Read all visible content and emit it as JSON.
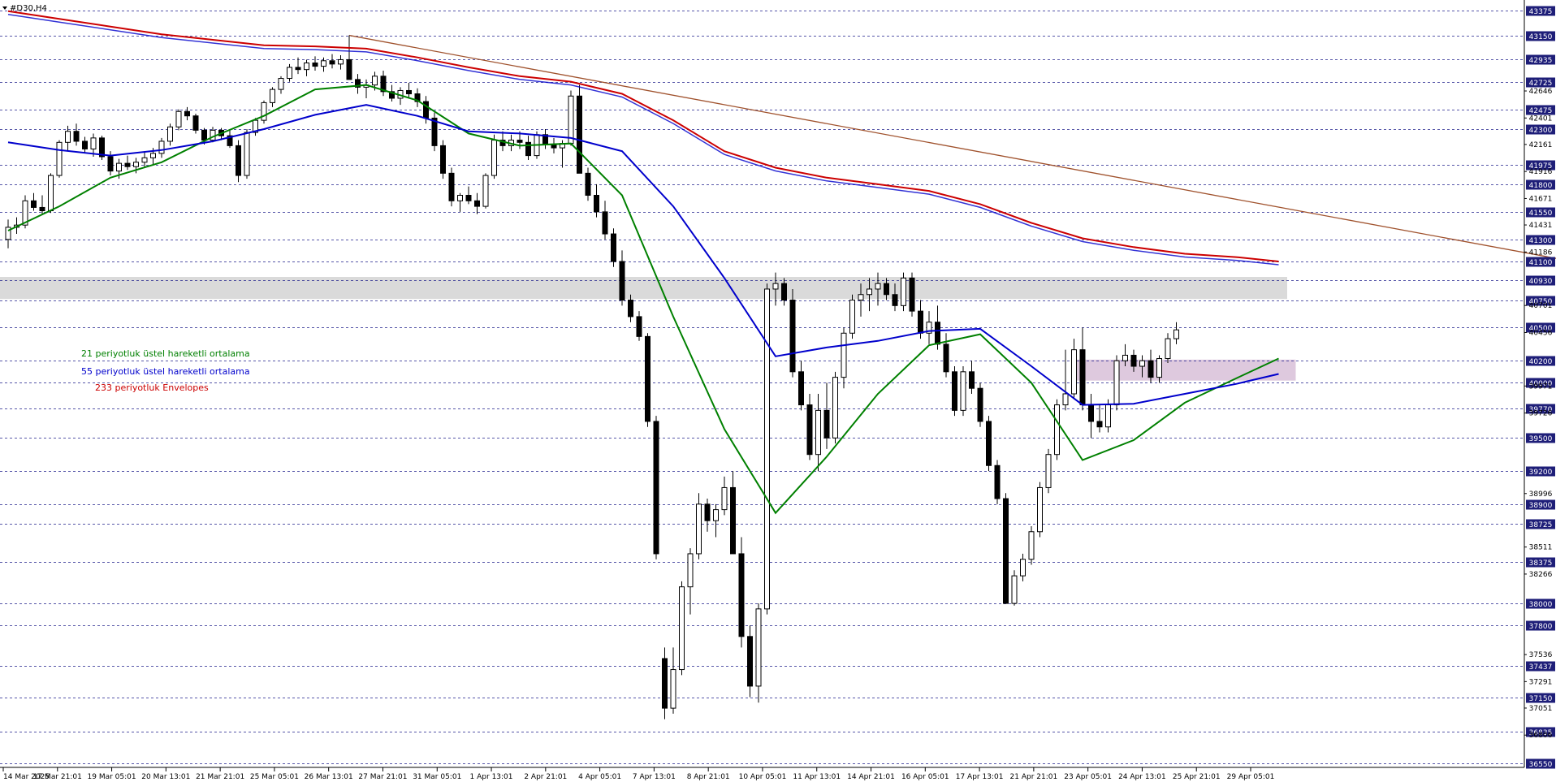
{
  "window": {
    "title": "#D30,H4"
  },
  "legend": [
    {
      "label": "21 periyotluk üstel hareketli ortalama",
      "color": "#008000"
    },
    {
      "label": "55 periyotluk üstel hareketli ortalama",
      "color": "#0000cc"
    },
    {
      "label": "233 periyotluk Envelopes",
      "color": "#cc0000"
    }
  ],
  "colors": {
    "background": "#ffffff",
    "grid": "#1e1e8c",
    "candle_body_up": "#ffffff",
    "candle_body_down": "#000000",
    "trendline": "#a0522d",
    "price_tag": "#1e1e78",
    "resistance_zone": "#d3d3d3",
    "support_zone": "#d8bfd8"
  },
  "chart_data": {
    "type": "candlestick",
    "symbol": "#D30",
    "timeframe": "H4",
    "ylim": [
      36550,
      43500
    ],
    "price_levels": [
      "43375",
      "43150",
      "42935",
      "42725",
      "42475",
      "42300",
      "41975",
      "41800",
      "41550",
      "41300",
      "41100",
      "40930",
      "40750",
      "40500",
      "40200",
      "40000",
      "39770",
      "39500",
      "39200",
      "38900",
      "38725",
      "38375",
      "38000",
      "37800",
      "37437",
      "37150",
      "36835",
      "36550"
    ],
    "minor_price_labels": [
      "42646",
      "42401",
      "42161",
      "41916",
      "41671",
      "41431",
      "41186",
      "40701",
      "40456",
      "39971",
      "39726",
      "38996",
      "38511",
      "38266",
      "37536",
      "37291",
      "37051",
      "36806"
    ],
    "x_labels": [
      "14 Mar 2025",
      "17 Mar 21:01",
      "19 Mar 05:01",
      "20 Mar 13:01",
      "21 Mar 21:01",
      "25 Mar 05:01",
      "26 Mar 13:01",
      "27 Mar 21:01",
      "31 Mar 05:01",
      "1 Apr 13:01",
      "2 Apr 21:01",
      "4 Apr 05:01",
      "7 Apr 13:01",
      "8 Apr 21:01",
      "10 Apr 05:01",
      "11 Apr 13:01",
      "14 Apr 21:01",
      "16 Apr 05:01",
      "17 Apr 13:01",
      "21 Apr 21:01",
      "23 Apr 05:01",
      "24 Apr 13:01",
      "25 Apr 21:01",
      "29 Apr 05:01"
    ],
    "candles": [
      [
        41300,
        41480,
        41220,
        41410
      ],
      [
        41410,
        41500,
        41350,
        41430
      ],
      [
        41430,
        41700,
        41400,
        41650
      ],
      [
        41650,
        41720,
        41560,
        41590
      ],
      [
        41590,
        41700,
        41520,
        41560
      ],
      [
        41560,
        41900,
        41540,
        41880
      ],
      [
        41880,
        42200,
        41860,
        42180
      ],
      [
        42180,
        42330,
        42100,
        42280
      ],
      [
        42280,
        42350,
        42150,
        42190
      ],
      [
        42190,
        42230,
        42080,
        42120
      ],
      [
        42120,
        42260,
        42050,
        42220
      ],
      [
        42220,
        42240,
        42020,
        42050
      ],
      [
        42050,
        42100,
        41880,
        41920
      ],
      [
        41920,
        42030,
        41850,
        41990
      ],
      [
        41990,
        42060,
        41930,
        41960
      ],
      [
        41960,
        42040,
        41900,
        42000
      ],
      [
        42000,
        42090,
        41950,
        42040
      ],
      [
        42040,
        42130,
        41980,
        42080
      ],
      [
        42080,
        42220,
        42040,
        42190
      ],
      [
        42190,
        42350,
        42150,
        42320
      ],
      [
        42320,
        42480,
        42290,
        42460
      ],
      [
        42460,
        42500,
        42380,
        42420
      ],
      [
        42420,
        42440,
        42260,
        42290
      ],
      [
        42290,
        42310,
        42160,
        42200
      ],
      [
        42200,
        42320,
        42180,
        42290
      ],
      [
        42290,
        42310,
        42200,
        42240
      ],
      [
        42240,
        42290,
        42130,
        42150
      ],
      [
        42150,
        42200,
        41820,
        41880
      ],
      [
        41880,
        42300,
        41850,
        42270
      ],
      [
        42270,
        42400,
        42240,
        42380
      ],
      [
        42380,
        42560,
        42350,
        42540
      ],
      [
        42540,
        42680,
        42500,
        42660
      ],
      [
        42660,
        42780,
        42620,
        42760
      ],
      [
        42760,
        42890,
        42730,
        42860
      ],
      [
        42860,
        42950,
        42800,
        42840
      ],
      [
        42840,
        42930,
        42780,
        42900
      ],
      [
        42900,
        42960,
        42830,
        42870
      ],
      [
        42870,
        42950,
        42820,
        42920
      ],
      [
        42920,
        42980,
        42850,
        42890
      ],
      [
        42890,
        42970,
        42840,
        42930
      ],
      [
        42930,
        43150,
        42880,
        42750
      ],
      [
        42750,
        42800,
        42620,
        42680
      ],
      [
        42680,
        42750,
        42580,
        42700
      ],
      [
        42700,
        42820,
        42650,
        42780
      ],
      [
        42780,
        42830,
        42600,
        42640
      ],
      [
        42640,
        42700,
        42550,
        42580
      ],
      [
        42580,
        42680,
        42520,
        42650
      ],
      [
        42650,
        42720,
        42580,
        42620
      ],
      [
        42620,
        42670,
        42500,
        42550
      ],
      [
        42550,
        42600,
        42350,
        42400
      ],
      [
        42400,
        42450,
        42100,
        42150
      ],
      [
        42150,
        42200,
        41850,
        41900
      ],
      [
        41900,
        41950,
        41600,
        41650
      ],
      [
        41650,
        41720,
        41550,
        41700
      ],
      [
        41700,
        41780,
        41620,
        41650
      ],
      [
        41650,
        41720,
        41530,
        41600
      ],
      [
        41600,
        41900,
        41580,
        41880
      ],
      [
        41880,
        42250,
        41850,
        42200
      ],
      [
        42200,
        42280,
        42100,
        42150
      ],
      [
        42150,
        42250,
        42100,
        42200
      ],
      [
        42200,
        42280,
        42120,
        42180
      ],
      [
        42180,
        42240,
        42020,
        42060
      ],
      [
        42060,
        42280,
        42030,
        42250
      ],
      [
        42250,
        42300,
        42120,
        42160
      ],
      [
        42160,
        42220,
        42080,
        42130
      ],
      [
        42130,
        42200,
        41950,
        42170
      ],
      [
        42170,
        42650,
        42150,
        42600
      ],
      [
        42600,
        42700,
        41950,
        41900
      ],
      [
        41900,
        41950,
        41650,
        41700
      ],
      [
        41700,
        41800,
        41500,
        41550
      ],
      [
        41550,
        41650,
        41300,
        41350
      ],
      [
        41350,
        41400,
        41050,
        41100
      ],
      [
        41100,
        41200,
        40700,
        40750
      ],
      [
        40750,
        40800,
        40550,
        40600
      ],
      [
        40600,
        40650,
        40380,
        40420
      ],
      [
        40420,
        40450,
        39600,
        39650
      ],
      [
        39650,
        39700,
        38400,
        38450
      ],
      [
        37500,
        37600,
        36950,
        37050
      ],
      [
        37050,
        37600,
        37000,
        37400
      ],
      [
        37400,
        38200,
        37350,
        38150
      ],
      [
        38150,
        38500,
        37900,
        38450
      ],
      [
        38450,
        39000,
        38400,
        38900
      ],
      [
        38900,
        38950,
        38650,
        38750
      ],
      [
        38750,
        38900,
        38600,
        38850
      ],
      [
        38850,
        39150,
        38800,
        39050
      ],
      [
        39050,
        39200,
        38600,
        38450
      ],
      [
        38450,
        38600,
        37600,
        37700
      ],
      [
        37700,
        37800,
        37150,
        37250
      ],
      [
        37250,
        38000,
        37100,
        37950
      ],
      [
        37950,
        40900,
        37900,
        40850
      ],
      [
        40850,
        41000,
        40700,
        40900
      ],
      [
        40900,
        40950,
        40700,
        40750
      ],
      [
        40750,
        40850,
        40050,
        40100
      ],
      [
        40100,
        40200,
        39750,
        39800
      ],
      [
        39800,
        39900,
        39300,
        39350
      ],
      [
        39350,
        39900,
        39200,
        39750
      ],
      [
        39750,
        40000,
        39400,
        39500
      ],
      [
        39500,
        40100,
        39450,
        40050
      ],
      [
        40050,
        40500,
        39950,
        40450
      ],
      [
        40450,
        40800,
        40400,
        40750
      ],
      [
        40750,
        40900,
        40600,
        40800
      ],
      [
        40800,
        40950,
        40650,
        40850
      ],
      [
        40850,
        41000,
        40700,
        40900
      ],
      [
        40900,
        40950,
        40750,
        40800
      ],
      [
        40800,
        40900,
        40650,
        40700
      ],
      [
        40700,
        41000,
        40650,
        40950
      ],
      [
        40950,
        41000,
        40600,
        40650
      ],
      [
        40650,
        40750,
        40400,
        40450
      ],
      [
        40450,
        40650,
        40350,
        40550
      ],
      [
        40550,
        40700,
        40300,
        40350
      ],
      [
        40350,
        40450,
        40050,
        40100
      ],
      [
        40100,
        40150,
        39700,
        39750
      ],
      [
        39750,
        40150,
        39700,
        40100
      ],
      [
        40100,
        40200,
        39900,
        39950
      ],
      [
        39950,
        40000,
        39600,
        39650
      ],
      [
        39650,
        39700,
        39200,
        39250
      ],
      [
        39250,
        39300,
        38900,
        38950
      ],
      [
        38950,
        39000,
        38350,
        38000
      ],
      [
        38000,
        38300,
        37980,
        38250
      ],
      [
        38250,
        38450,
        38200,
        38400
      ],
      [
        38400,
        38700,
        38350,
        38650
      ],
      [
        38650,
        39100,
        38600,
        39050
      ],
      [
        39050,
        39400,
        39000,
        39350
      ],
      [
        39350,
        39850,
        39300,
        39800
      ],
      [
        39800,
        40300,
        39750,
        39900
      ],
      [
        39900,
        40400,
        39850,
        40300
      ],
      [
        40300,
        40500,
        39750,
        39800
      ],
      [
        39800,
        39900,
        39500,
        39650
      ],
      [
        39650,
        39800,
        39550,
        39600
      ],
      [
        39600,
        39850,
        39550,
        39800
      ],
      [
        39800,
        40250,
        39750,
        40200
      ],
      [
        40200,
        40350,
        40150,
        40250
      ],
      [
        40250,
        40300,
        40100,
        40150
      ],
      [
        40150,
        40250,
        40050,
        40200
      ],
      [
        40200,
        40300,
        40000,
        40050
      ],
      [
        40050,
        40250,
        40000,
        40220
      ],
      [
        40220,
        40450,
        40180,
        40400
      ],
      [
        40400,
        40550,
        40350,
        40480
      ]
    ],
    "series": [
      {
        "name": "21 periyotluk üstel hareketli ortalama",
        "color": "#008000",
        "values": [
          [
            0,
            41380
          ],
          [
            6,
            41600
          ],
          [
            12,
            41860
          ],
          [
            18,
            42000
          ],
          [
            24,
            42230
          ],
          [
            30,
            42420
          ],
          [
            36,
            42660
          ],
          [
            42,
            42700
          ],
          [
            48,
            42560
          ],
          [
            54,
            42260
          ],
          [
            60,
            42150
          ],
          [
            66,
            42170
          ],
          [
            72,
            41700
          ],
          [
            78,
            40600
          ],
          [
            84,
            39580
          ],
          [
            90,
            38820
          ],
          [
            96,
            39330
          ],
          [
            102,
            39900
          ],
          [
            108,
            40340
          ],
          [
            114,
            40440
          ],
          [
            120,
            40000
          ],
          [
            126,
            39300
          ],
          [
            132,
            39480
          ],
          [
            138,
            39820
          ],
          [
            144,
            40040
          ],
          [
            149,
            40220
          ]
        ]
      },
      {
        "name": "55 periyotluk üstel hareketli ortalama",
        "color": "#0000cc",
        "values": [
          [
            0,
            42180
          ],
          [
            6,
            42110
          ],
          [
            12,
            42060
          ],
          [
            18,
            42110
          ],
          [
            24,
            42190
          ],
          [
            30,
            42300
          ],
          [
            36,
            42430
          ],
          [
            42,
            42520
          ],
          [
            48,
            42420
          ],
          [
            54,
            42280
          ],
          [
            60,
            42260
          ],
          [
            66,
            42220
          ],
          [
            72,
            42100
          ],
          [
            78,
            41600
          ],
          [
            84,
            40950
          ],
          [
            90,
            40240
          ],
          [
            96,
            40320
          ],
          [
            102,
            40380
          ],
          [
            108,
            40470
          ],
          [
            114,
            40490
          ],
          [
            120,
            40150
          ],
          [
            126,
            39800
          ],
          [
            132,
            39810
          ],
          [
            138,
            39900
          ],
          [
            144,
            39990
          ],
          [
            149,
            40080
          ]
        ]
      },
      {
        "name": "233 periyotluk Envelopes",
        "color": "#cc0000",
        "values": [
          [
            0,
            43370
          ],
          [
            6,
            43300
          ],
          [
            12,
            43230
          ],
          [
            18,
            43160
          ],
          [
            24,
            43110
          ],
          [
            30,
            43060
          ],
          [
            36,
            43050
          ],
          [
            42,
            43030
          ],
          [
            48,
            42950
          ],
          [
            54,
            42860
          ],
          [
            60,
            42780
          ],
          [
            66,
            42730
          ],
          [
            72,
            42620
          ],
          [
            78,
            42380
          ],
          [
            84,
            42100
          ],
          [
            90,
            41950
          ],
          [
            96,
            41860
          ],
          [
            102,
            41800
          ],
          [
            108,
            41740
          ],
          [
            114,
            41620
          ],
          [
            120,
            41450
          ],
          [
            126,
            41310
          ],
          [
            132,
            41230
          ],
          [
            138,
            41170
          ],
          [
            144,
            41140
          ],
          [
            149,
            41100
          ]
        ]
      }
    ],
    "trendline": {
      "from": [
        40,
        43150
      ],
      "to": [
        187,
        41050
      ]
    },
    "zones": [
      {
        "name": "resistance",
        "y": [
          40760,
          40960
        ],
        "x": [
          0,
          150
        ]
      },
      {
        "name": "support",
        "y": [
          40020,
          40210
        ],
        "x": [
          126,
          151
        ]
      }
    ],
    "grid": true
  }
}
